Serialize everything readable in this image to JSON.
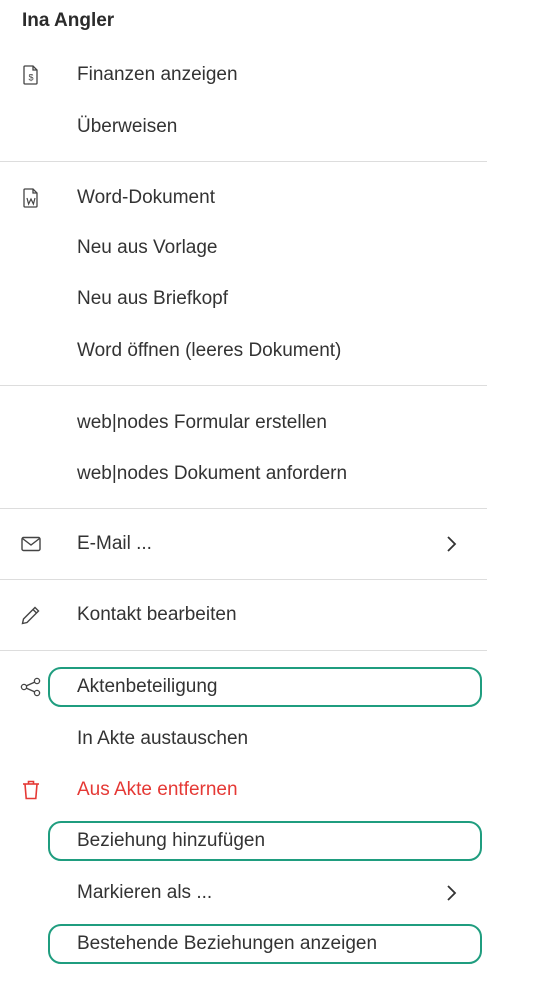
{
  "menu": {
    "title": "Ina Angler",
    "items": {
      "finance": "Finanzen anzeigen",
      "transfer": "Überweisen",
      "word": "Word-Dokument",
      "template": "Neu aus Vorlage",
      "letterhead": "Neu aus Briefkopf",
      "word_blank": "Word öffnen (leeres Dokument)",
      "webnodes_form": "web|nodes Formular erstellen",
      "webnodes_doc": "web|nodes Dokument anfordern",
      "email": "E-Mail ...",
      "edit_contact": "Kontakt bearbeiten",
      "case_participation": "Aktenbeteiligung",
      "swap_in_case": "In Akte austauschen",
      "remove_from_case": "Aus Akte entfernen",
      "add_relation": "Beziehung hinzufügen",
      "mark_as": "Markieren als ...",
      "show_relations": "Bestehende Beziehungen anzeigen"
    }
  },
  "colors": {
    "highlight": "#1f9d7f",
    "danger": "#e53935",
    "divider": "#dddddd"
  }
}
